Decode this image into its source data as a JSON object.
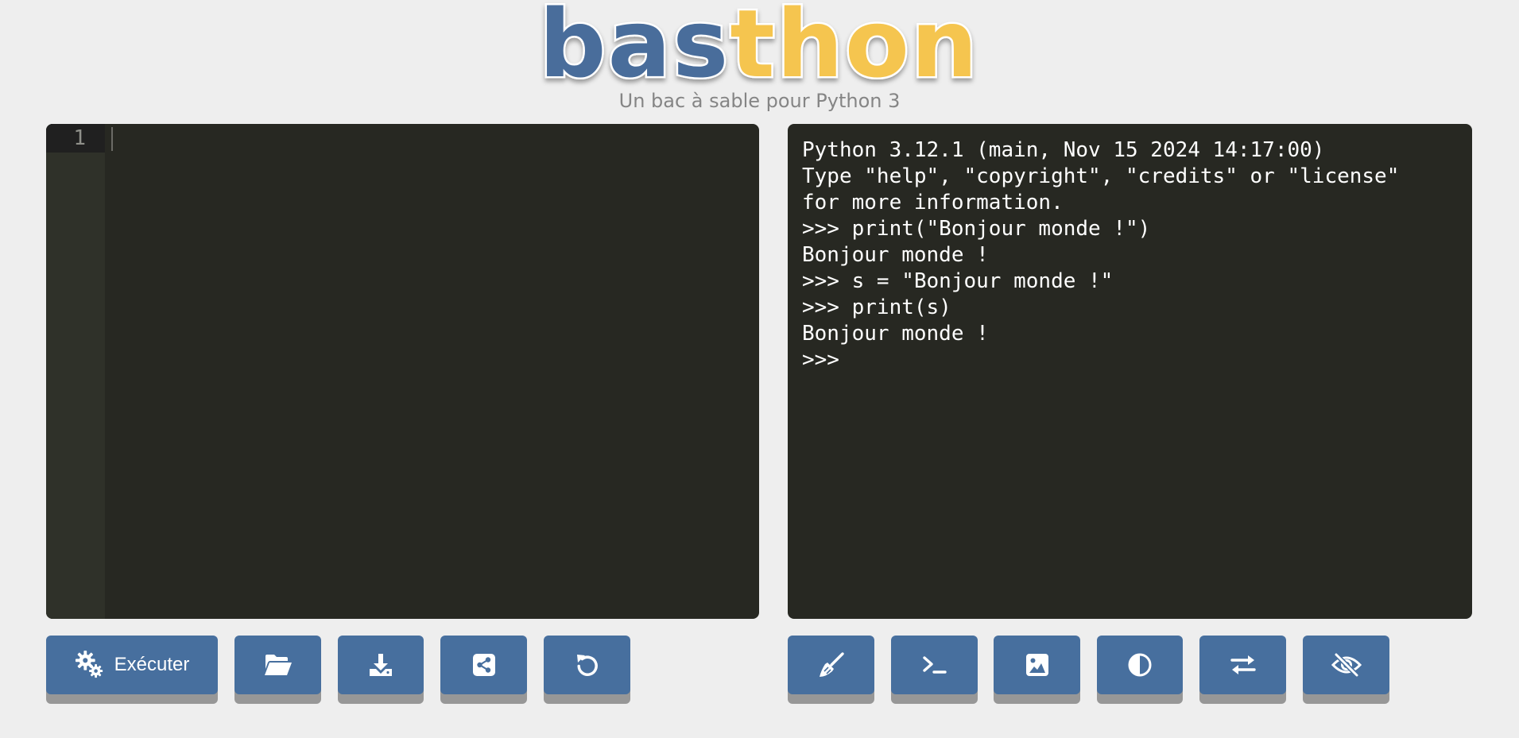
{
  "header": {
    "logo_text": "basthon",
    "subtitle": "Un bac à sable pour Python 3"
  },
  "editor": {
    "line_numbers": [
      "1"
    ]
  },
  "console": {
    "lines": [
      "Python 3.12.1 (main, Nov 15 2024 14:17:00)",
      "Type \"help\", \"copyright\", \"credits\" or \"license\"",
      "for more information.",
      ">>> print(\"Bonjour monde !\")",
      "Bonjour monde !",
      ">>> s = \"Bonjour monde !\"",
      ">>> print(s)",
      "Bonjour monde !",
      ">>> "
    ]
  },
  "toolbar_left": {
    "run_label": "Exécuter"
  },
  "icons": {
    "run": "gears-icon",
    "open": "folder-open-icon",
    "download": "download-icon",
    "share": "share-icon",
    "reset": "undo-icon",
    "clear": "broom-icon",
    "shell": "terminal-icon",
    "graphics": "image-icon",
    "theme": "contrast-icon",
    "swap": "swap-icon",
    "hide": "eye-slash-icon"
  },
  "colors": {
    "background": "#eeeeee",
    "panel": "#272822",
    "button": "#476f9e",
    "logo_blue": "#4a6d9b",
    "logo_yellow": "#f5c54f"
  }
}
